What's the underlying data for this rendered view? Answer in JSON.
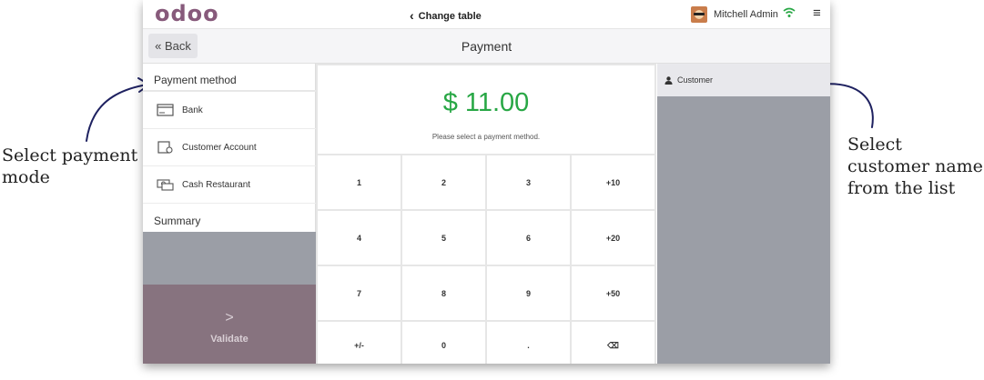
{
  "annotations": {
    "left": "Select payment mode",
    "right": "Select customer name from the list"
  },
  "header": {
    "logo": "odoo",
    "change_table": "Change table",
    "user": "Mitchell Admin"
  },
  "subheader": {
    "back_label": "« Back",
    "title": "Payment"
  },
  "payment_methods": {
    "title": "Payment method",
    "items": [
      {
        "label": "Bank",
        "icon": "bank-card-icon"
      },
      {
        "label": "Customer Account",
        "icon": "customer-account-icon"
      },
      {
        "label": "Cash Restaurant",
        "icon": "cash-icon"
      }
    ]
  },
  "summary": {
    "title": "Summary"
  },
  "validate": {
    "chevron": ">",
    "label": "Validate"
  },
  "amount": {
    "value": "$ 11.00",
    "hint": "Please select a payment method."
  },
  "keypad": [
    "1",
    "2",
    "3",
    "+10",
    "4",
    "5",
    "6",
    "+20",
    "7",
    "8",
    "9",
    "+50",
    "+/-",
    "0",
    ".",
    "⌫"
  ],
  "customer": {
    "label": "Customer"
  },
  "colors": {
    "brand": "#875a7b",
    "amount": "#28a745",
    "validate": "#87737f",
    "panel_gray": "#9b9ea6"
  }
}
